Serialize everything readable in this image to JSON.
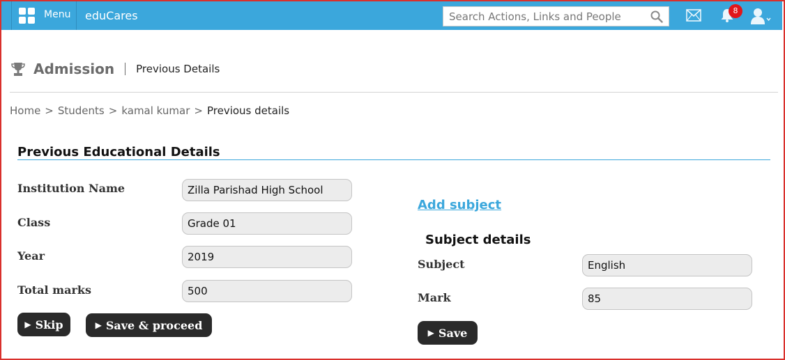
{
  "topbar": {
    "menu_label": "Menu",
    "brand": "eduCares",
    "search_placeholder": "Search Actions, Links and People",
    "notification_count": "8",
    "bar_color": "#3ba7dc"
  },
  "header": {
    "title": "Admission",
    "subtitle": "Previous Details"
  },
  "breadcrumb": {
    "items": [
      "Home",
      "Students",
      "kamal kumar"
    ],
    "current": "Previous details",
    "separator": ">"
  },
  "education": {
    "section_title": "Previous Educational Details",
    "fields": [
      {
        "label": "Institution Name",
        "value": "Zilla Parishad High School"
      },
      {
        "label": "Class",
        "value": "Grade 01"
      },
      {
        "label": "Year",
        "value": "2019"
      },
      {
        "label": "Total marks",
        "value": "500"
      }
    ],
    "skip_label": "Skip",
    "save_proceed_label": "Save & proceed"
  },
  "subject": {
    "add_link": "Add subject",
    "section_title": "Subject details",
    "fields": [
      {
        "label": "Subject",
        "value": "English"
      },
      {
        "label": "Mark",
        "value": "85"
      }
    ],
    "save_label": "Save"
  },
  "icons": {
    "menu": "grid-icon",
    "search": "search-icon",
    "mail": "mail-icon",
    "notifications": "bell-icon",
    "user": "user-icon",
    "page": "trophy-icon",
    "button_prefix": "play-icon"
  }
}
